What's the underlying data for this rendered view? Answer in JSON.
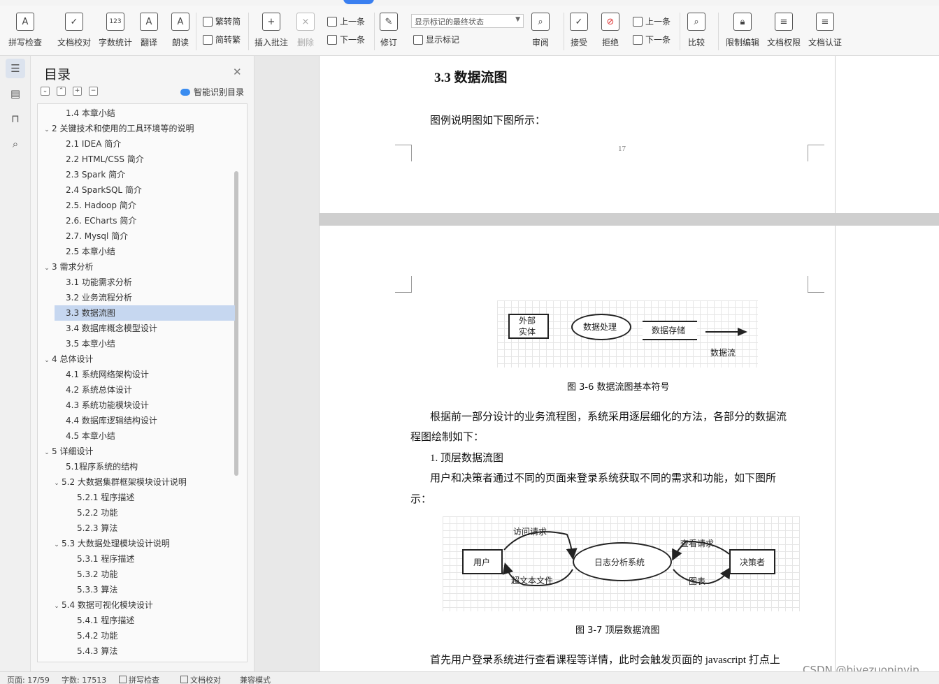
{
  "ribbon": {
    "spellcheck": "拼写检查",
    "proofread": "文档校对",
    "wordcount": "字数统计",
    "translate": "翻译",
    "readaloud": "朗读",
    "trad_to_simp": "繁转简",
    "simp_to_trad": "简转繁",
    "insert_comment": "插入批注",
    "delete": "删除",
    "prev": "上一条",
    "next": "下一条",
    "revise": "修订",
    "mark_state": "显示标记的最终状态",
    "show_marks": "显示标记",
    "review": "审阅",
    "accept": "接受",
    "reject": "拒绝",
    "prev2": "上一条",
    "next2": "下一条",
    "compare": "比较",
    "restrict": "限制编辑",
    "permission": "文档权限",
    "certify": "文档认证"
  },
  "toc": {
    "title": "目录",
    "smart_label": "智能识别目录",
    "items": [
      {
        "text": "1.4  本章小结",
        "level": 2,
        "chev": ""
      },
      {
        "text": "2    关键技术和使用的工具环境等的说明",
        "level": 1,
        "chev": "v"
      },
      {
        "text": "2.1 IDEA 简介",
        "level": 2,
        "chev": ""
      },
      {
        "text": "2.2 HTML/CSS 简介",
        "level": 2,
        "chev": ""
      },
      {
        "text": "2.3 Spark 简介",
        "level": 2,
        "chev": ""
      },
      {
        "text": "2.4 SparkSQL 简介",
        "level": 2,
        "chev": ""
      },
      {
        "text": "2.5. Hadoop 简介",
        "level": 2,
        "chev": ""
      },
      {
        "text": "2.6. ECharts 简介",
        "level": 2,
        "chev": ""
      },
      {
        "text": "2.7. Mysql 简介",
        "level": 2,
        "chev": ""
      },
      {
        "text": "2.5  本章小结",
        "level": 2,
        "chev": ""
      },
      {
        "text": "3    需求分析",
        "level": 1,
        "chev": "v"
      },
      {
        "text": "3.1  功能需求分析",
        "level": 2,
        "chev": ""
      },
      {
        "text": "3.2  业务流程分析",
        "level": 2,
        "chev": ""
      },
      {
        "text": "3.3  数据流图",
        "level": 2,
        "chev": "",
        "selected": true
      },
      {
        "text": "3.4  数据库概念模型设计",
        "level": 2,
        "chev": ""
      },
      {
        "text": "3.5  本章小结",
        "level": 2,
        "chev": ""
      },
      {
        "text": "4    总体设计",
        "level": 1,
        "chev": "v"
      },
      {
        "text": "4.1  系统网络架构设计",
        "level": 2,
        "chev": ""
      },
      {
        "text": "4.2  系统总体设计",
        "level": 2,
        "chev": ""
      },
      {
        "text": "4.3  系统功能模块设计",
        "level": 2,
        "chev": ""
      },
      {
        "text": "4.4  数据库逻辑结构设计",
        "level": 2,
        "chev": ""
      },
      {
        "text": "4.5  本章小结",
        "level": 2,
        "chev": ""
      },
      {
        "text": "5    详细设计",
        "level": 1,
        "chev": "v"
      },
      {
        "text": "5.1程序系统的结构",
        "level": 2,
        "chev": ""
      },
      {
        "text": "5.2    大数据集群框架模块设计说明",
        "level": 2,
        "chev": "v"
      },
      {
        "text": "5.2.1  程序描述",
        "level": 3,
        "chev": ""
      },
      {
        "text": "5.2.2  功能",
        "level": 3,
        "chev": ""
      },
      {
        "text": "5.2.3  算法",
        "level": 3,
        "chev": ""
      },
      {
        "text": "5.3    大数据处理模块设计说明",
        "level": 2,
        "chev": "v"
      },
      {
        "text": "5.3.1  程序描述",
        "level": 3,
        "chev": ""
      },
      {
        "text": "5.3.2  功能",
        "level": 3,
        "chev": ""
      },
      {
        "text": "5.3.3  算法",
        "level": 3,
        "chev": ""
      },
      {
        "text": "5.4    数据可视化模块设计",
        "level": 2,
        "chev": "v"
      },
      {
        "text": "5.4.1  程序描述",
        "level": 3,
        "chev": ""
      },
      {
        "text": "5.4.2  功能",
        "level": 3,
        "chev": ""
      },
      {
        "text": "5.4.3  算法",
        "level": 3,
        "chev": ""
      }
    ]
  },
  "doc": {
    "heading": "3.3  数据流图",
    "legend_intro": "图例说明图如下图所示：",
    "page_number": "17",
    "fig1": {
      "external_entity_line1": "外部",
      "external_entity_line2": "实体",
      "process": "数据处理",
      "store": "数据存储",
      "flow": "数据流",
      "caption": "图 3-6 数据流图基本符号"
    },
    "para1_line1": "根据前一部分设计的业务流程图，系统采用逐层细化的方法，各部分的数据流",
    "para1_line2": "程图绘制如下：",
    "list1": "1.  顶层数据流图",
    "para2_line1": "用户和决策者通过不同的页面来登录系统获取不同的需求和功能，如下图所",
    "para2_line2": "示：",
    "fig2": {
      "user": "用户",
      "system": "日志分析系统",
      "decider": "决策者",
      "access": "访问请求",
      "hypertext": "超文本文件",
      "view": "查看请求",
      "chart": "图表",
      "caption": "图 3-7  顶层数据流图"
    },
    "para3": "首先用户登录系统进行查看课程等详情，此时会触发页面的 javascript 打点上"
  },
  "watermark": "CSDN @biyezuopinvip",
  "status": {
    "page": "页面: 17/59",
    "words": "字数: 17513",
    "spell": "拼写检查",
    "proof": "文档校对",
    "compat": "兼容模式"
  }
}
